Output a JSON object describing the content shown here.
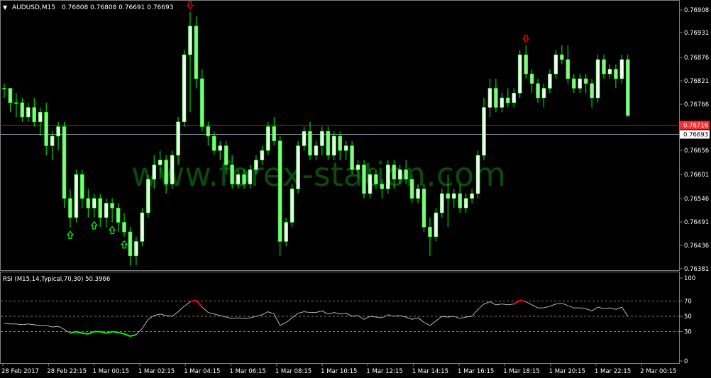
{
  "header": {
    "menu_arrow": "▼",
    "symbol": "AUDUSD,M15",
    "ohlc": "0.76808 0.76808 0.76691 0.76693"
  },
  "watermark": "www.forex-station.com",
  "colors": {
    "background": "#000000",
    "bull_body": "#ffffff",
    "bear_body": "#90ee90",
    "wick": "#00ff00",
    "bid_line": "#ff0000",
    "ask_line": "#7f8a9a",
    "price_tag_red": "#ff2a2a",
    "price_tag_white": "#ffffff",
    "signal_down": "#ff0000",
    "signal_up": "#00ff00",
    "rsi_line": "#c8c8c8",
    "rsi_overbought": "#ff0000",
    "rsi_oversold": "#00ff00",
    "level_line": "#c8a070",
    "frame": "#808080"
  },
  "icons": {
    "down_signal": "down-arrow-icon",
    "up_signal": "up-arrow-icon"
  },
  "price_axis": {
    "labels": [
      "0.76908",
      "0.76931",
      "0.76876",
      "0.76821",
      "0.76766",
      "0.76656",
      "0.76601",
      "0.76546",
      "0.76491",
      "0.76436",
      "0.76381"
    ],
    "bid_tag": "0.76716",
    "last_tag": "0.76693"
  },
  "rsi": {
    "label": "RSI (M15,14,Typical,70,30) 50.3966",
    "axis_labels": [
      "100",
      "70",
      "50",
      "30",
      "0"
    ],
    "levels": [
      70,
      50,
      30
    ]
  },
  "time_axis": {
    "labels": [
      "28 Feb 2017",
      "28 Feb 22:15",
      "1 Mar 00:15",
      "1 Mar 02:15",
      "1 Mar 04:15",
      "1 Mar 06:15",
      "1 Mar 08:15",
      "1 Mar 10:15",
      "1 Mar 12:15",
      "1 Mar 14:15",
      "1 Mar 16:15",
      "1 Mar 18:15",
      "1 Mar 20:15",
      "1 Mar 22:15",
      "2 Mar 00:15"
    ]
  },
  "chart_data": {
    "type": "candlestick",
    "symbol": "AUDUSD",
    "timeframe": "M15",
    "y_range": [
      0.7637,
      0.7693
    ],
    "bid": 0.76716,
    "last": 0.76693,
    "candles": [
      [
        0.7675,
        0.7676,
        0.7673,
        0.7675
      ],
      [
        0.7675,
        0.7675,
        0.767,
        0.7672
      ],
      [
        0.7672,
        0.7674,
        0.7669,
        0.7672
      ],
      [
        0.7672,
        0.7673,
        0.7668,
        0.7669
      ],
      [
        0.7669,
        0.7672,
        0.7668,
        0.7671
      ],
      [
        0.7671,
        0.7673,
        0.7667,
        0.7668
      ],
      [
        0.7668,
        0.7671,
        0.7665,
        0.767
      ],
      [
        0.767,
        0.7672,
        0.7661,
        0.7663
      ],
      [
        0.7663,
        0.7666,
        0.766,
        0.7665
      ],
      [
        0.7665,
        0.7668,
        0.7662,
        0.7667
      ],
      [
        0.7667,
        0.7668,
        0.765,
        0.7652
      ],
      [
        0.7652,
        0.7654,
        0.7646,
        0.7648
      ],
      [
        0.7648,
        0.7658,
        0.7647,
        0.7657
      ],
      [
        0.7657,
        0.7658,
        0.765,
        0.7652
      ],
      [
        0.7652,
        0.7654,
        0.7648,
        0.765
      ],
      [
        0.765,
        0.7653,
        0.7648,
        0.7652
      ],
      [
        0.7652,
        0.7653,
        0.7646,
        0.7648
      ],
      [
        0.7648,
        0.7652,
        0.7646,
        0.7651
      ],
      [
        0.7651,
        0.7652,
        0.7647,
        0.765
      ],
      [
        0.765,
        0.7651,
        0.7645,
        0.7647
      ],
      [
        0.7647,
        0.7649,
        0.7644,
        0.7645
      ],
      [
        0.7645,
        0.7646,
        0.7638,
        0.764
      ],
      [
        0.764,
        0.7644,
        0.7638,
        0.7643
      ],
      [
        0.7643,
        0.765,
        0.7642,
        0.7649
      ],
      [
        0.7649,
        0.7657,
        0.7648,
        0.7656
      ],
      [
        0.7656,
        0.7661,
        0.7654,
        0.7659
      ],
      [
        0.7659,
        0.7662,
        0.7656,
        0.766
      ],
      [
        0.766,
        0.7661,
        0.7653,
        0.7655
      ],
      [
        0.7655,
        0.7662,
        0.7654,
        0.7661
      ],
      [
        0.7661,
        0.7669,
        0.7659,
        0.7668
      ],
      [
        0.7668,
        0.7683,
        0.7667,
        0.7682
      ],
      [
        0.7682,
        0.7691,
        0.767,
        0.7688
      ],
      [
        0.7688,
        0.769,
        0.7675,
        0.7677
      ],
      [
        0.7677,
        0.7679,
        0.7666,
        0.7667
      ],
      [
        0.7667,
        0.7668,
        0.7663,
        0.7665
      ],
      [
        0.7665,
        0.7666,
        0.7661,
        0.7662
      ],
      [
        0.7662,
        0.7664,
        0.766,
        0.7663
      ],
      [
        0.7663,
        0.7664,
        0.7657,
        0.7659
      ],
      [
        0.7659,
        0.7661,
        0.7654,
        0.7655
      ],
      [
        0.7655,
        0.7658,
        0.7654,
        0.7657
      ],
      [
        0.7657,
        0.7658,
        0.7654,
        0.7655
      ],
      [
        0.7655,
        0.7659,
        0.7654,
        0.7658
      ],
      [
        0.7658,
        0.7661,
        0.7657,
        0.766
      ],
      [
        0.766,
        0.7663,
        0.7659,
        0.7662
      ],
      [
        0.7662,
        0.7668,
        0.7661,
        0.7667
      ],
      [
        0.7667,
        0.7669,
        0.7663,
        0.7664
      ],
      [
        0.7664,
        0.7665,
        0.764,
        0.7643
      ],
      [
        0.7643,
        0.7648,
        0.7642,
        0.7647
      ],
      [
        0.7647,
        0.7655,
        0.7646,
        0.7654
      ],
      [
        0.7654,
        0.7664,
        0.7653,
        0.7663
      ],
      [
        0.7663,
        0.7667,
        0.7662,
        0.7666
      ],
      [
        0.7666,
        0.7668,
        0.766,
        0.7661
      ],
      [
        0.7661,
        0.7664,
        0.766,
        0.7663
      ],
      [
        0.7663,
        0.7667,
        0.7661,
        0.7666
      ],
      [
        0.7666,
        0.7667,
        0.766,
        0.7661
      ],
      [
        0.7661,
        0.7666,
        0.766,
        0.7665
      ],
      [
        0.7665,
        0.7666,
        0.766,
        0.7662
      ],
      [
        0.7662,
        0.7664,
        0.766,
        0.7663
      ],
      [
        0.7663,
        0.7664,
        0.7657,
        0.7658
      ],
      [
        0.7658,
        0.766,
        0.7656,
        0.7659
      ],
      [
        0.7659,
        0.766,
        0.7652,
        0.7653
      ],
      [
        0.7653,
        0.7658,
        0.7652,
        0.7657
      ],
      [
        0.7657,
        0.7658,
        0.7654,
        0.7655
      ],
      [
        0.7655,
        0.7656,
        0.7652,
        0.7654
      ],
      [
        0.7654,
        0.766,
        0.7653,
        0.7659
      ],
      [
        0.7659,
        0.766,
        0.7654,
        0.7656
      ],
      [
        0.7656,
        0.7659,
        0.7655,
        0.7658
      ],
      [
        0.7658,
        0.766,
        0.7655,
        0.7656
      ],
      [
        0.7656,
        0.7657,
        0.7651,
        0.7652
      ],
      [
        0.7652,
        0.7655,
        0.7651,
        0.7654
      ],
      [
        0.7654,
        0.7655,
        0.7645,
        0.7646
      ],
      [
        0.7646,
        0.7648,
        0.764,
        0.7644
      ],
      [
        0.7644,
        0.765,
        0.7643,
        0.7649
      ],
      [
        0.7649,
        0.7654,
        0.7648,
        0.7653
      ],
      [
        0.7653,
        0.7657,
        0.7646,
        0.7652
      ],
      [
        0.7652,
        0.7654,
        0.765,
        0.7653
      ],
      [
        0.7653,
        0.7655,
        0.7649,
        0.765
      ],
      [
        0.765,
        0.7653,
        0.7649,
        0.7652
      ],
      [
        0.7652,
        0.7654,
        0.7651,
        0.7653
      ],
      [
        0.7653,
        0.7662,
        0.7652,
        0.7661
      ],
      [
        0.7661,
        0.7673,
        0.766,
        0.7671
      ],
      [
        0.7671,
        0.7677,
        0.7669,
        0.7675
      ],
      [
        0.7675,
        0.7677,
        0.767,
        0.7671
      ],
      [
        0.7671,
        0.7674,
        0.767,
        0.7673
      ],
      [
        0.7673,
        0.7675,
        0.7671,
        0.7672
      ],
      [
        0.7672,
        0.7675,
        0.7671,
        0.7674
      ],
      [
        0.7674,
        0.7683,
        0.7673,
        0.7682
      ],
      [
        0.7682,
        0.7684,
        0.7677,
        0.7678
      ],
      [
        0.7678,
        0.7679,
        0.7674,
        0.7676
      ],
      [
        0.7676,
        0.7677,
        0.7672,
        0.7673
      ],
      [
        0.7673,
        0.7676,
        0.7671,
        0.7675
      ],
      [
        0.7675,
        0.7679,
        0.7674,
        0.7678
      ],
      [
        0.7678,
        0.7683,
        0.7677,
        0.7682
      ],
      [
        0.7682,
        0.7684,
        0.768,
        0.7681
      ],
      [
        0.7681,
        0.7684,
        0.7676,
        0.7677
      ],
      [
        0.7677,
        0.7678,
        0.7674,
        0.7675
      ],
      [
        0.7675,
        0.7678,
        0.7674,
        0.7677
      ],
      [
        0.7677,
        0.7678,
        0.7674,
        0.7676
      ],
      [
        0.7676,
        0.7677,
        0.7671,
        0.7673
      ],
      [
        0.7673,
        0.7682,
        0.7672,
        0.7681
      ],
      [
        0.7681,
        0.7682,
        0.7677,
        0.7678
      ],
      [
        0.7678,
        0.768,
        0.7677,
        0.7679
      ],
      [
        0.7679,
        0.768,
        0.7675,
        0.7677
      ],
      [
        0.7677,
        0.7682,
        0.7676,
        0.7681
      ],
      [
        0.7681,
        0.7682,
        0.7669,
        0.76693
      ]
    ],
    "down_signals": [
      31,
      87
    ],
    "up_signals": [
      11,
      15,
      18,
      20
    ],
    "rsi_values": [
      41,
      40,
      40,
      39,
      40,
      39,
      38,
      38,
      36,
      37,
      33,
      28,
      30,
      28,
      27,
      30,
      30,
      28,
      30,
      29,
      27,
      24,
      26,
      34,
      46,
      51,
      53,
      51,
      50,
      56,
      63,
      69,
      71,
      62,
      55,
      53,
      51,
      49,
      47,
      48,
      47,
      48,
      50,
      52,
      56,
      53,
      38,
      42,
      48,
      54,
      56,
      55,
      55,
      57,
      53,
      55,
      53,
      54,
      50,
      51,
      46,
      50,
      49,
      48,
      52,
      50,
      51,
      49,
      46,
      48,
      42,
      38,
      44,
      50,
      49,
      50,
      47,
      49,
      50,
      59,
      66,
      69,
      65,
      66,
      65,
      66,
      71,
      69,
      65,
      61,
      61,
      63,
      66,
      67,
      64,
      61,
      61,
      60,
      57,
      62,
      60,
      61,
      59,
      62,
      50
    ]
  }
}
